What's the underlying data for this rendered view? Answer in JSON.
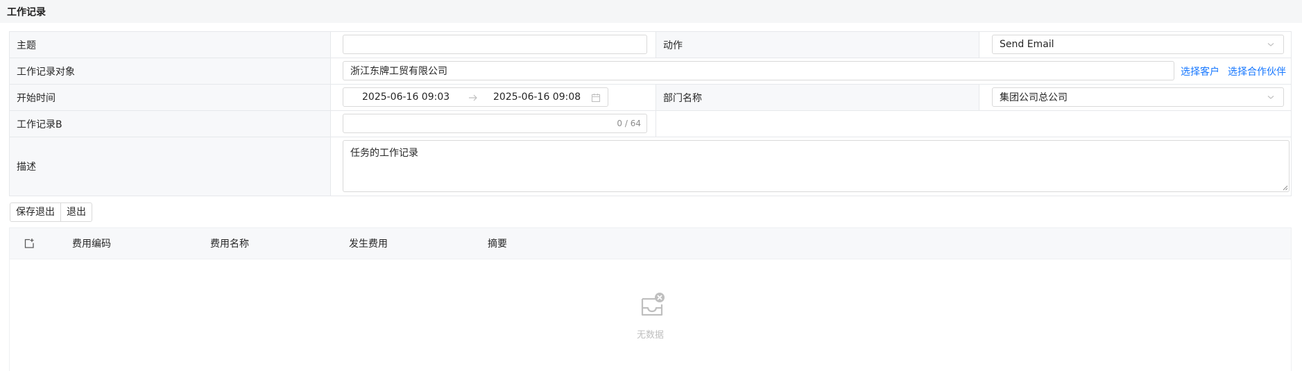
{
  "page": {
    "title": "工作记录"
  },
  "form": {
    "subject": {
      "label": "主题",
      "value": ""
    },
    "action": {
      "label": "动作",
      "value": "Send Email"
    },
    "target": {
      "label": "工作记录对象",
      "value": "浙江东牌工贸有限公司",
      "select_customer": "选择客户",
      "select_partner": "选择合作伙伴"
    },
    "start_time": {
      "label": "开始时间",
      "start": "2025-06-16 09:03",
      "end": "2025-06-16 09:08"
    },
    "department": {
      "label": "部门名称",
      "value": "集团公司总公司"
    },
    "record_b": {
      "label": "工作记录B",
      "value": "",
      "counter": "0 / 64"
    },
    "description": {
      "label": "描述",
      "value": "任务的工作记录"
    }
  },
  "actions": {
    "save_exit": "保存退出",
    "exit": "退出"
  },
  "expense_table": {
    "columns": [
      "费用编码",
      "费用名称",
      "发生费用",
      "摘要"
    ],
    "rows": [],
    "empty_text": "无数据"
  },
  "colors": {
    "link": "#1677ff",
    "border": "#d9d9d9",
    "label_bg": "#f7f8fa"
  }
}
